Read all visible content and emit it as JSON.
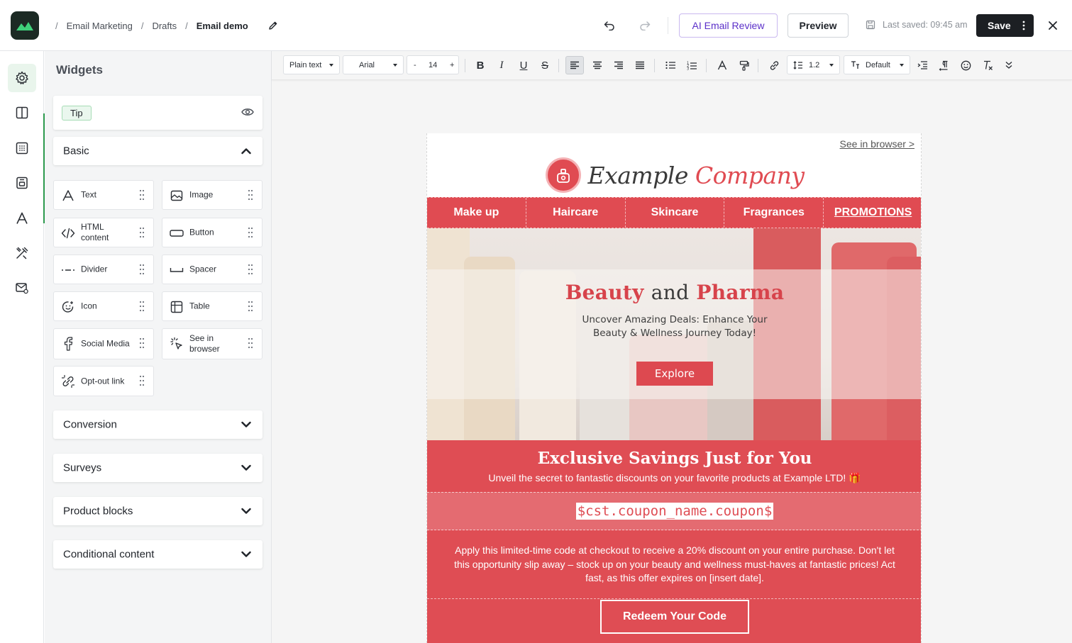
{
  "header": {
    "breadcrumbs": [
      "Email Marketing",
      "Drafts",
      "Email demo"
    ],
    "ai_review_label": "AI Email Review",
    "preview_label": "Preview",
    "last_saved": "Last saved: 09:45 am",
    "save_label": "Save"
  },
  "panel": {
    "title": "Widgets",
    "tip_label": "Tip",
    "basic_label": "Basic",
    "widgets": [
      {
        "label": "Text",
        "icon": "text-icon"
      },
      {
        "label": "Image",
        "icon": "image-icon"
      },
      {
        "label": "HTML content",
        "icon": "code-icon"
      },
      {
        "label": "Button",
        "icon": "button-icon"
      },
      {
        "label": "Divider",
        "icon": "divider-icon"
      },
      {
        "label": "Spacer",
        "icon": "spacer-icon"
      },
      {
        "label": "Icon",
        "icon": "smiley-plus-icon"
      },
      {
        "label": "Table",
        "icon": "table-icon"
      },
      {
        "label": "Social Media",
        "icon": "facebook-icon"
      },
      {
        "label": "See in browser",
        "icon": "cursor-click-icon"
      },
      {
        "label": "Opt-out link",
        "icon": "unlink-icon"
      }
    ],
    "sections": [
      "Conversion",
      "Surveys",
      "Product blocks",
      "Conditional content"
    ]
  },
  "toolbar": {
    "format": "Plain text",
    "font": "Arial",
    "size": "14",
    "size_minus": "-",
    "size_plus": "+",
    "line_height": "1.2",
    "style": "Default"
  },
  "email": {
    "see_in_browser": "See in browser >",
    "brand_part1": "Example",
    "brand_part2": "Company",
    "nav": [
      "Make up",
      "Haircare",
      "Skincare",
      "Fragrances",
      "PROMOTIONS"
    ],
    "hero_title_1": "Beauty",
    "hero_title_2": "and",
    "hero_title_3": "Pharma",
    "hero_subtitle": "Uncover Amazing Deals: Enhance Your Beauty & Wellness Journey Today!",
    "hero_button": "Explore",
    "promo_title": "Exclusive Savings Just for You",
    "promo_subtitle": "Unveil the secret to fantastic discounts on your favorite products at Example LTD! 🎁",
    "coupon_code": "$cst.coupon_name.coupon$",
    "promo_body": "Apply this limited-time code at checkout to receive a 20% discount on your entire purchase. Don't let this opportunity slip away – stock up on your beauty and wellness must-haves at fantastic prices! Act fast, as this offer expires on [insert date].",
    "redeem_button": "Redeem Your Code"
  },
  "colors": {
    "brand_red": "#e04b52",
    "accent_green": "#2d9a4e",
    "ai_purple": "#5b2fc9"
  }
}
